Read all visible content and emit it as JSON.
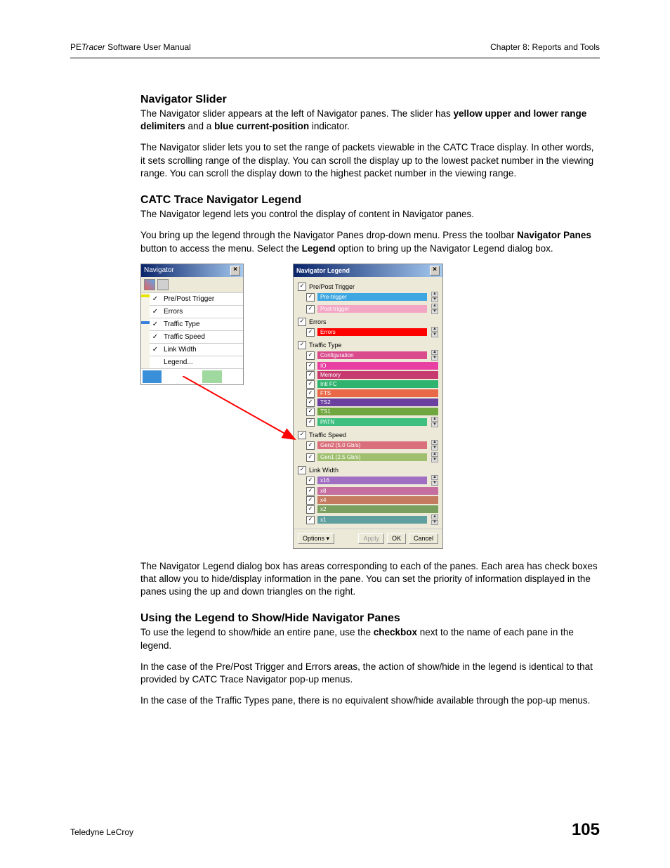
{
  "header": {
    "product_italic": "Tracer",
    "product_pre": "PE",
    "manual": " Software User Manual",
    "chapter": "Chapter 8: Reports and Tools"
  },
  "section1": {
    "title": "Navigator Slider",
    "p1_a": "The Navigator slider appears at the left of Navigator panes. The slider has ",
    "p1_b": "yellow upper and lower range delimiters",
    "p1_c": " and a ",
    "p1_d": "blue current-position",
    "p1_e": " indicator.",
    "p2": "The Navigator slider lets you to set the range of packets viewable in the CATC Trace display. In other words, it sets scrolling range of the display. You can scroll the display up to the lowest packet number in the viewing range. You can scroll the display down to the highest packet number in the viewing range."
  },
  "section2": {
    "title": "CATC Trace Navigator Legend",
    "p1": "The Navigator legend lets you control the display of content in Navigator panes.",
    "p2_a": "You bring up the legend through the Navigator Panes drop-down menu. Press the toolbar ",
    "p2_b": "Navigator Panes",
    "p2_c": " button to access the menu. Select the ",
    "p2_d": "Legend",
    "p2_e": " option to bring up the Navigator Legend dialog box.",
    "p3": "The Navigator Legend dialog box has areas corresponding to each of the panes. Each area has check boxes that allow you to hide/display information in the pane. You can set the priority of information displayed in the panes using the up and down triangles on the right."
  },
  "section3": {
    "title": "Using the Legend to Show/Hide Navigator Panes",
    "p1_a": "To use the legend to show/hide an entire pane, use the ",
    "p1_b": "checkbox",
    "p1_c": " next to the name of each pane in the legend.",
    "p2": "In the case of the Pre/Post Trigger and Errors areas, the action of show/hide in the legend is identical to that provided by CATC Trace Navigator pop-up menus.",
    "p3": "In the case of the Traffic Types pane, there is no equivalent show/hide available through the pop-up menus."
  },
  "nav_popup": {
    "title": "Navigator",
    "items": [
      {
        "checked": true,
        "label": "Pre/Post Trigger"
      },
      {
        "checked": true,
        "label": "Errors"
      },
      {
        "checked": true,
        "label": "Traffic Type"
      },
      {
        "checked": true,
        "label": "Traffic Speed"
      },
      {
        "checked": true,
        "label": "Link Width"
      },
      {
        "checked": false,
        "label": "Legend..."
      }
    ]
  },
  "legend_dialog": {
    "title": "Navigator Legend",
    "groups": [
      {
        "name": "Pre/Post Trigger",
        "items": [
          {
            "label": "Pre-trigger",
            "color": "#3ea6e0"
          },
          {
            "label": "Post-trigger",
            "color": "#f2a6c4"
          }
        ]
      },
      {
        "name": "Errors",
        "items": [
          {
            "label": "Errors",
            "color": "#ff0000"
          }
        ]
      },
      {
        "name": "Traffic Type",
        "items": [
          {
            "label": "Configuration",
            "color": "#d94b8c"
          },
          {
            "label": "IO",
            "color": "#e83fa3"
          },
          {
            "label": "Memory",
            "color": "#c73a6f"
          },
          {
            "label": "Intl FC",
            "color": "#2fb36f"
          },
          {
            "label": "FTS",
            "color": "#e86848"
          },
          {
            "label": "TS2",
            "color": "#6b3fa0"
          },
          {
            "label": "TS1",
            "color": "#6fa63f"
          },
          {
            "label": "PATN",
            "color": "#3fbf7f"
          }
        ]
      },
      {
        "name": "Traffic Speed",
        "items": [
          {
            "label": "Gen2 (5.0 Gb/s)",
            "color": "#d96f7b"
          },
          {
            "label": "Gen1 (2.5 Gb/s)",
            "color": "#9fbf6f"
          }
        ]
      },
      {
        "name": "Link Width",
        "items": [
          {
            "label": "x16",
            "color": "#a06fc4"
          },
          {
            "label": "x8",
            "color": "#c46fa0"
          },
          {
            "label": "x4",
            "color": "#c47b5f"
          },
          {
            "label": "x2",
            "color": "#7b9f5f"
          },
          {
            "label": "x1",
            "color": "#5f9f9f"
          }
        ]
      }
    ],
    "buttons": {
      "options": "Options ▾",
      "apply": "Apply",
      "ok": "OK",
      "cancel": "Cancel"
    }
  },
  "footer": {
    "company": "Teledyne LeCroy",
    "page": "105"
  }
}
